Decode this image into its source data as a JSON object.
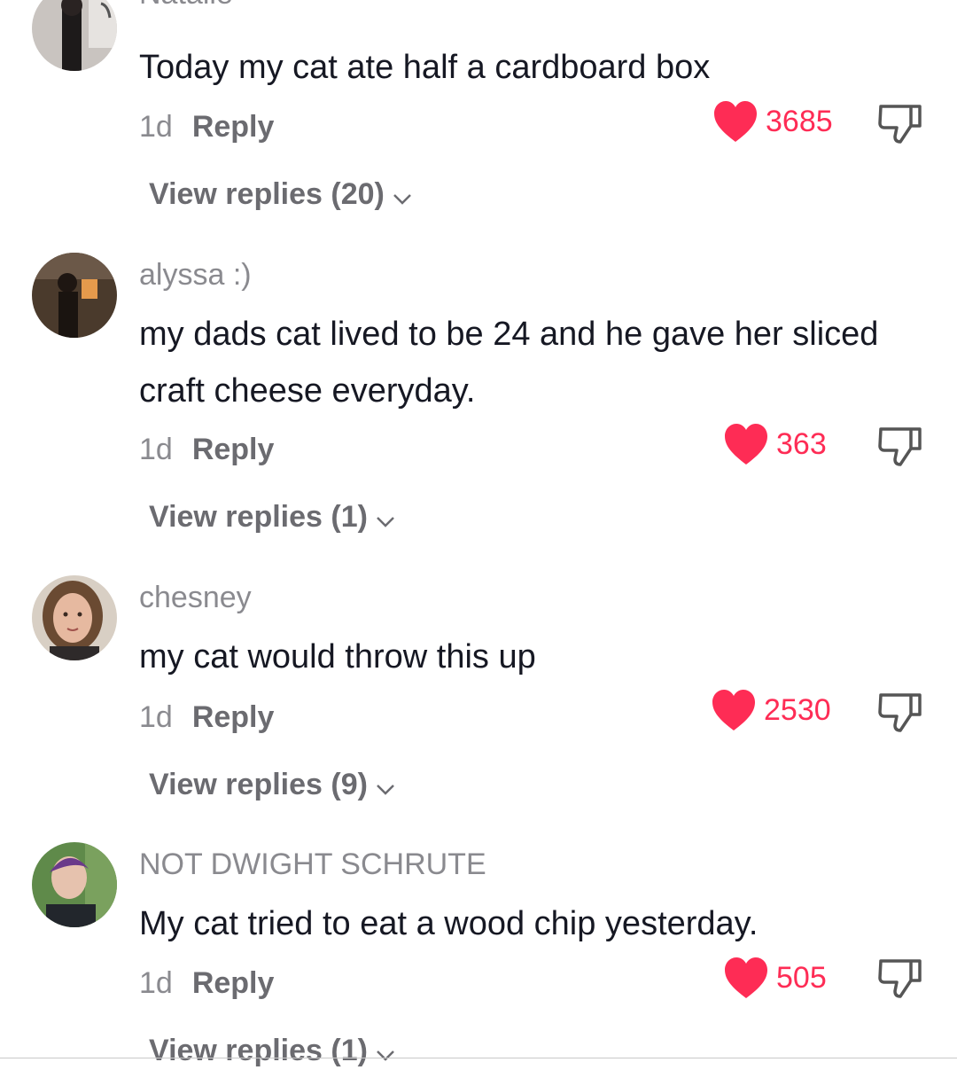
{
  "comments": [
    {
      "username": "Natalie",
      "text": "Today my cat ate half a cardboard box",
      "time": "1d",
      "reply_label": "Reply",
      "likes": "3685",
      "view_replies": "View replies (20)"
    },
    {
      "username": "alyssa :)",
      "text": "my dads cat lived to be 24 and he gave her sliced craft cheese everyday.",
      "time": "1d",
      "reply_label": "Reply",
      "likes": "363",
      "view_replies": "View replies (1)"
    },
    {
      "username": "chesney",
      "text": "my cat would throw this up",
      "time": "1d",
      "reply_label": "Reply",
      "likes": "2530",
      "view_replies": "View replies (9)"
    },
    {
      "username": "NOT DWIGHT SCHRUTE",
      "text": "My cat tried to eat a wood chip yesterday.",
      "time": "1d",
      "reply_label": "Reply",
      "likes": "505",
      "view_replies": "View replies (1)"
    }
  ],
  "colors": {
    "like": "#fe2c55",
    "text": "#161823",
    "muted": "#8a8a8f"
  },
  "icons": {
    "like": "heart-icon",
    "dislike": "thumbs-down-icon",
    "expand": "chevron-down-icon"
  }
}
